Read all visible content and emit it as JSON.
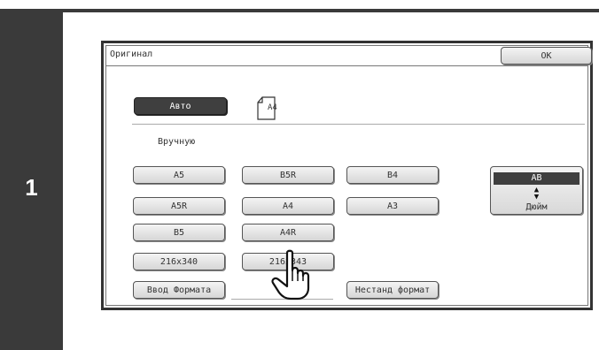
{
  "step": {
    "number": "1"
  },
  "panel": {
    "title": "Оригинал",
    "ok_label": "OK",
    "auto_label": "Авто",
    "auto_size": "A4",
    "manual_label": "Вручную",
    "size_buttons": [
      "A5",
      "B5R",
      "B4",
      "A5R",
      "A4",
      "A3",
      "B5",
      "A4R",
      "216x340",
      "216x343"
    ],
    "input_size_label": "Ввод Формата",
    "nonstandard_label": "Нестанд формат",
    "unit": {
      "selected": "AB",
      "alternate": "Дюйм"
    }
  }
}
